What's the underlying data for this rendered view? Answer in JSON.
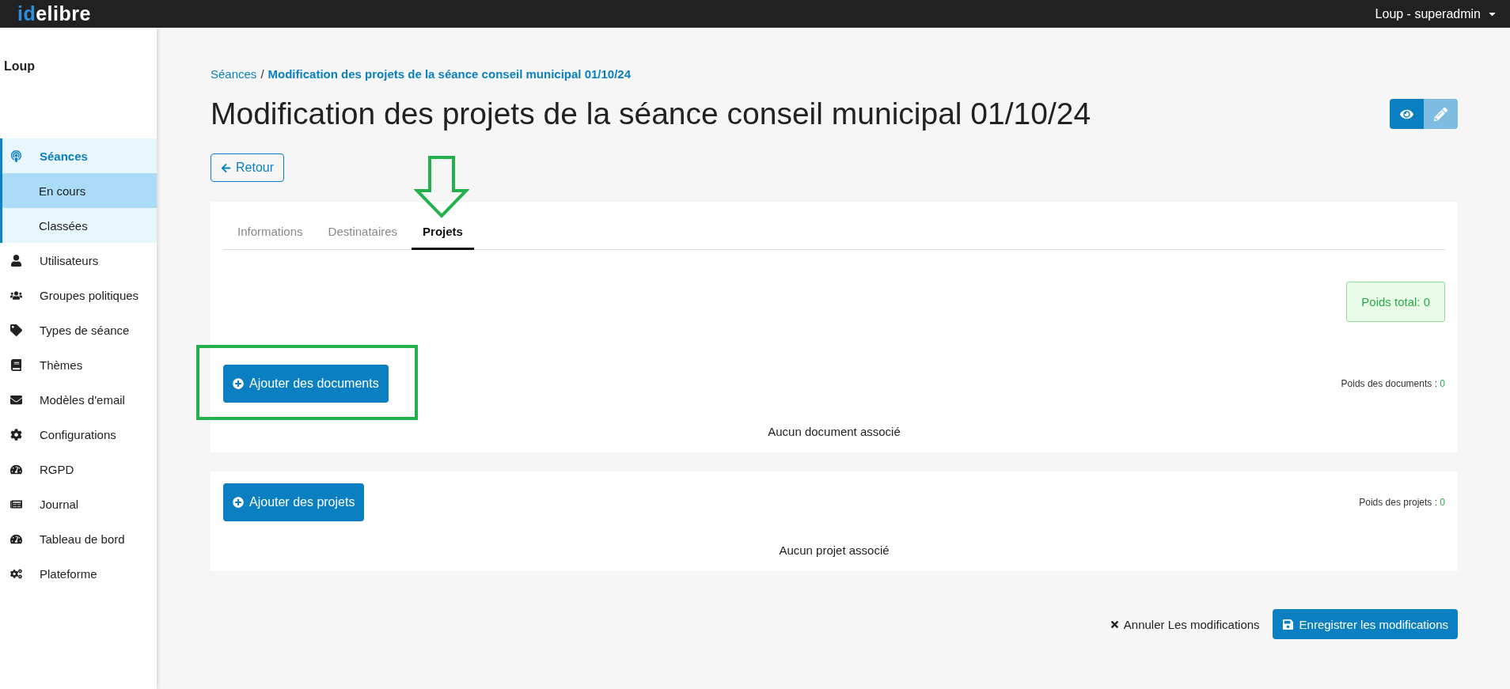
{
  "header": {
    "logo": {
      "prefix": "id",
      "name": "elibre"
    },
    "user_menu": "Loup - superadmin"
  },
  "sidebar": {
    "title": "Loup",
    "items": [
      {
        "label": "Séances",
        "selected": true,
        "children": [
          {
            "label": "En cours",
            "selected": true
          },
          {
            "label": "Classées",
            "selected": false
          }
        ]
      },
      {
        "label": "Utilisateurs",
        "selected": false
      },
      {
        "label": "Groupes politiques",
        "selected": false
      },
      {
        "label": "Types de séance",
        "selected": false
      },
      {
        "label": "Thèmes",
        "selected": false
      },
      {
        "label": "Modèles d'email",
        "selected": false
      },
      {
        "label": "Configurations",
        "selected": false
      },
      {
        "label": "RGPD",
        "selected": false
      },
      {
        "label": "Journal",
        "selected": false
      },
      {
        "label": "Tableau de bord",
        "selected": false
      },
      {
        "label": "Plateforme",
        "selected": false
      }
    ]
  },
  "breadcrumb": [
    {
      "label": "Séances",
      "current": false
    },
    {
      "label": "Modification des projets de la séance conseil municipal 01/10/24",
      "current": true
    }
  ],
  "breadcrumb_separator": "/",
  "title": "Modification des projets de la séance conseil municipal 01/10/24",
  "actions": [
    {
      "kind": "view",
      "disabled": false
    },
    {
      "kind": "edit",
      "disabled": true
    }
  ],
  "back_button": "Retour",
  "tabs": [
    {
      "label": "Informations",
      "selected": false
    },
    {
      "label": "Destinataires",
      "selected": false
    },
    {
      "label": "Projets",
      "selected": true
    }
  ],
  "total_weight": "Poids total: 0",
  "sections": [
    {
      "button": "Ajouter des documents",
      "weight_label": "Poids des documents :",
      "weight_value": "0",
      "empty_text": "Aucun document associé",
      "highlighted": true
    },
    {
      "button": "Ajouter des projets",
      "weight_label": "Poids des projets :",
      "weight_value": "0",
      "empty_text": "Aucun projet associé",
      "highlighted": false
    }
  ],
  "footer": {
    "cancel": "Annuler Les modifications",
    "save": "Enregistrer les modifications"
  }
}
